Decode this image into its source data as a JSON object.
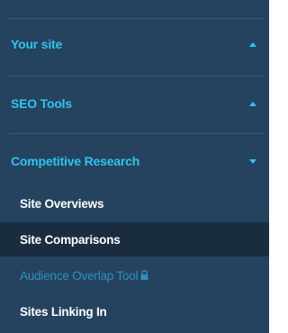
{
  "sidebar": {
    "sections": [
      {
        "label": "Your site",
        "state": "expanded-up",
        "caret": "caret-up-icon"
      },
      {
        "label": "SEO Tools",
        "state": "expanded-up",
        "caret": "caret-up-icon"
      },
      {
        "label": "Competitive Research",
        "state": "expanded",
        "caret": "caret-down-icon"
      }
    ],
    "items": [
      {
        "label": "Site Overviews",
        "active": false,
        "locked": false
      },
      {
        "label": "Site Comparisons",
        "active": true,
        "locked": false
      },
      {
        "label": "Audience Overlap Tool",
        "active": false,
        "locked": true,
        "icon": "lock-icon"
      },
      {
        "label": "Sites Linking In",
        "active": false,
        "locked": false
      }
    ]
  },
  "colors": {
    "background": "#25435f",
    "accent": "#2fc4ee",
    "active_background": "#1a2d40",
    "locked_text": "#2c8fc0",
    "divider": "#3d5a76"
  }
}
